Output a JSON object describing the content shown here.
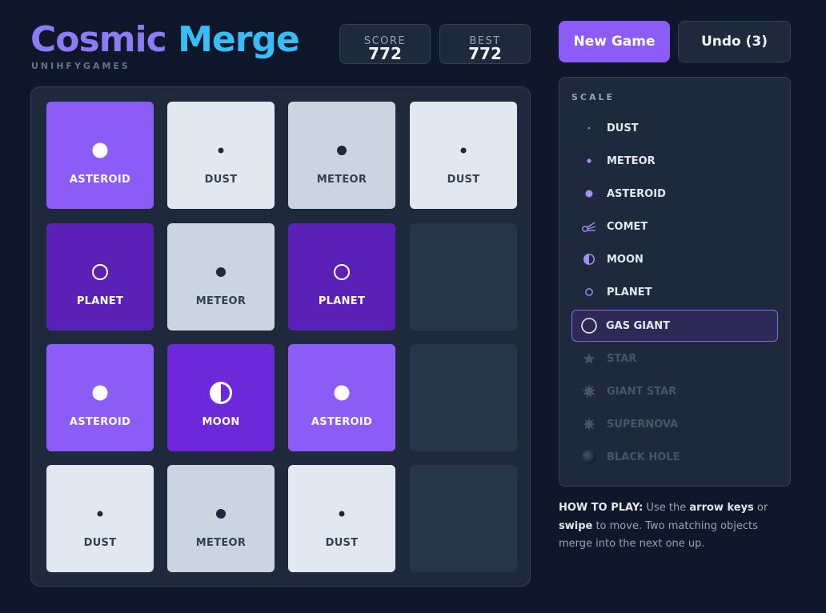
{
  "header": {
    "title_part1": "Cosmic",
    "title_part2": "Merge",
    "publisher": "UNIHFYGAMES",
    "score_label": "SCORE",
    "score_value": "772",
    "best_label": "BEST",
    "best_value": "772",
    "new_game_label": "New Game",
    "undo_label": "Undo (3)"
  },
  "board": {
    "rows": [
      [
        "ASTEROID",
        "DUST",
        "METEOR",
        "DUST"
      ],
      [
        "PLANET",
        "METEOR",
        "PLANET",
        ""
      ],
      [
        "ASTEROID",
        "MOON",
        "ASTEROID",
        ""
      ],
      [
        "DUST",
        "METEOR",
        "DUST",
        ""
      ]
    ]
  },
  "scale": {
    "title": "SCALE",
    "items": [
      {
        "label": "DUST",
        "icon": "tiny-dot-icon",
        "state": "unlocked"
      },
      {
        "label": "METEOR",
        "icon": "small-dot-icon",
        "state": "unlocked"
      },
      {
        "label": "ASTEROID",
        "icon": "dot-icon",
        "state": "unlocked"
      },
      {
        "label": "COMET",
        "icon": "comet-icon",
        "state": "unlocked"
      },
      {
        "label": "MOON",
        "icon": "half-moon-icon",
        "state": "unlocked"
      },
      {
        "label": "PLANET",
        "icon": "ring-icon",
        "state": "unlocked"
      },
      {
        "label": "GAS GIANT",
        "icon": "large-ring-icon",
        "state": "current"
      },
      {
        "label": "STAR",
        "icon": "star-icon",
        "state": "locked"
      },
      {
        "label": "GIANT STAR",
        "icon": "burst-icon",
        "state": "locked"
      },
      {
        "label": "SUPERNOVA",
        "icon": "supernova-icon",
        "state": "locked"
      },
      {
        "label": "BLACK HOLE",
        "icon": "black-hole-icon",
        "state": "locked"
      }
    ]
  },
  "howto": {
    "heading": "HOW TO PLAY:",
    "t1": " Use the ",
    "b1": "arrow keys",
    "t2": " or ",
    "b2": "swipe",
    "t3": " to move. Two matching objects merge into the next one up."
  },
  "colors": {
    "accent": "#8b5cf6",
    "title_blue": "#38bdf8",
    "background": "#0f172a"
  }
}
